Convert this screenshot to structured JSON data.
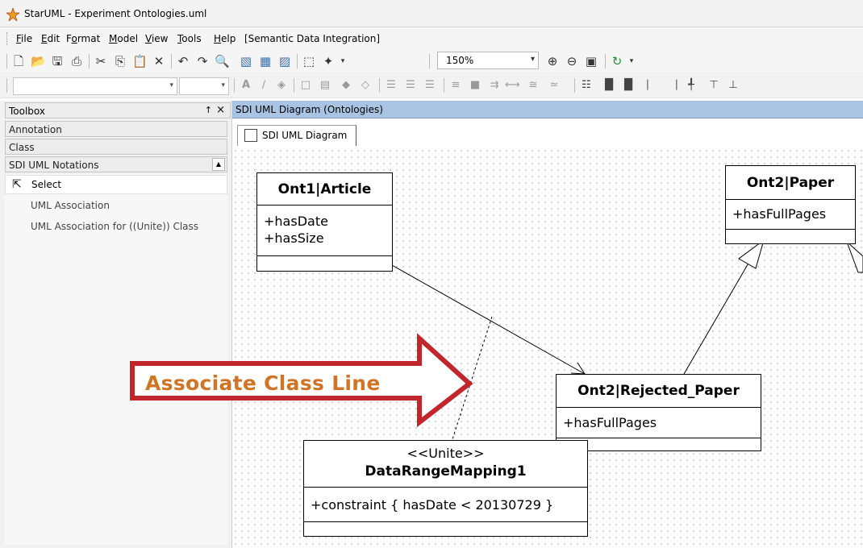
{
  "window": {
    "title": "StarUML - Experiment Ontologies.uml"
  },
  "menu": {
    "items": [
      {
        "label": "File",
        "u": "F",
        "rest": "ile"
      },
      {
        "label": "Edit",
        "u": "E",
        "rest": "dit"
      },
      {
        "label": "Format",
        "pre": "F",
        "u": "o",
        "rest": "rmat"
      },
      {
        "label": "Model",
        "u": "M",
        "rest": "odel"
      },
      {
        "label": "View",
        "u": "V",
        "rest": "iew"
      },
      {
        "label": "Tools",
        "u": "T",
        "rest": "ools"
      },
      {
        "label": "Help",
        "u": "H",
        "rest": "elp"
      },
      {
        "label": "[Semantic Data Integration]"
      }
    ]
  },
  "toolbar": {
    "zoom": "150%"
  },
  "toolbox": {
    "title": "Toolbox",
    "pin_glyph": "↑",
    "close_glyph": "×",
    "categories": [
      "Annotation",
      "Class",
      "SDI UML Notations"
    ],
    "select_label": "Select",
    "tools": [
      "UML Association",
      "UML Association for ((Unite)) Class"
    ]
  },
  "diagram": {
    "panel_title": "SDI UML Diagram (Ontologies)",
    "tab_label": "SDI UML Diagram",
    "classes": {
      "article": {
        "name": "Ont1|Article",
        "attrs": [
          "+hasDate",
          "+hasSize"
        ]
      },
      "paper": {
        "name": "Ont2|Paper",
        "attrs": [
          "+hasFullPages"
        ]
      },
      "rejected": {
        "name": "Ont2|Rejected_Paper",
        "attrs": [
          "+hasFullPages"
        ]
      },
      "mapping": {
        "stereotype": "<<Unite>>",
        "name": "DataRangeMapping1",
        "attrs": [
          "+constraint { hasDate < 20130729 }"
        ]
      }
    },
    "callout": {
      "text": "Associate Class Line",
      "color": "#cf7525",
      "arrow_border": "#c0262c"
    }
  }
}
